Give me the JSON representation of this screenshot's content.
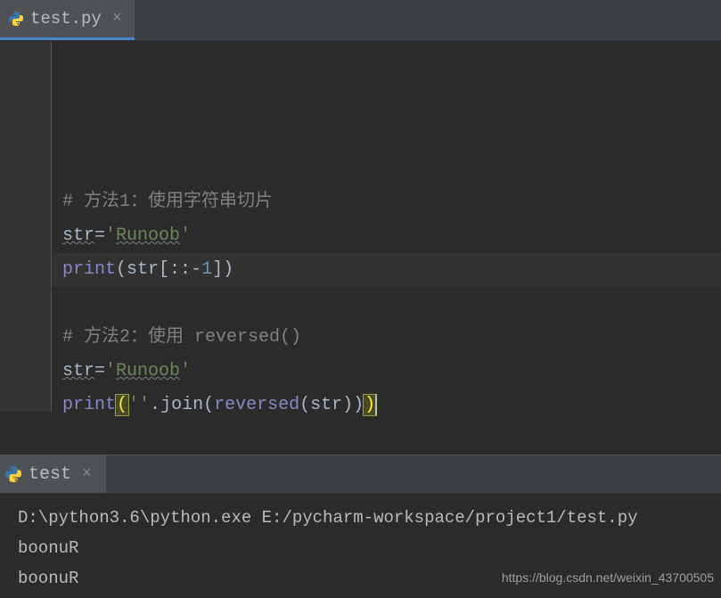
{
  "editor": {
    "tab": {
      "filename": "test.py"
    },
    "code": {
      "comment1": "# 方法1：使用字符串切片",
      "line2": {
        "var": "str",
        "op": "=",
        "quote": "'",
        "val": "Runoob"
      },
      "line3": {
        "fn": "print",
        "var": "str",
        "slice_punct_open": "[::-",
        "num": "1",
        "slice_punct_close": "])"
      },
      "comment2": "# 方法2：使用 reversed()",
      "line5": {
        "var": "str",
        "op": "=",
        "quote": "'",
        "val": "Runoob"
      },
      "line6": {
        "fn": "print",
        "open": "(",
        "q1": "''",
        "dot": ".",
        "join": "join",
        "open2": "(",
        "rev": "reversed",
        "open3": "(",
        "var": "str",
        "close3": ")",
        "close2": ")",
        "close1": ")"
      }
    }
  },
  "run": {
    "tab_label": "test",
    "console": {
      "cmd": "D:\\python3.6\\python.exe E:/pycharm-workspace/project1/test.py",
      "out1": "boonuR",
      "out2": "boonuR"
    }
  },
  "watermark": "https://blog.csdn.net/weixin_43700505"
}
